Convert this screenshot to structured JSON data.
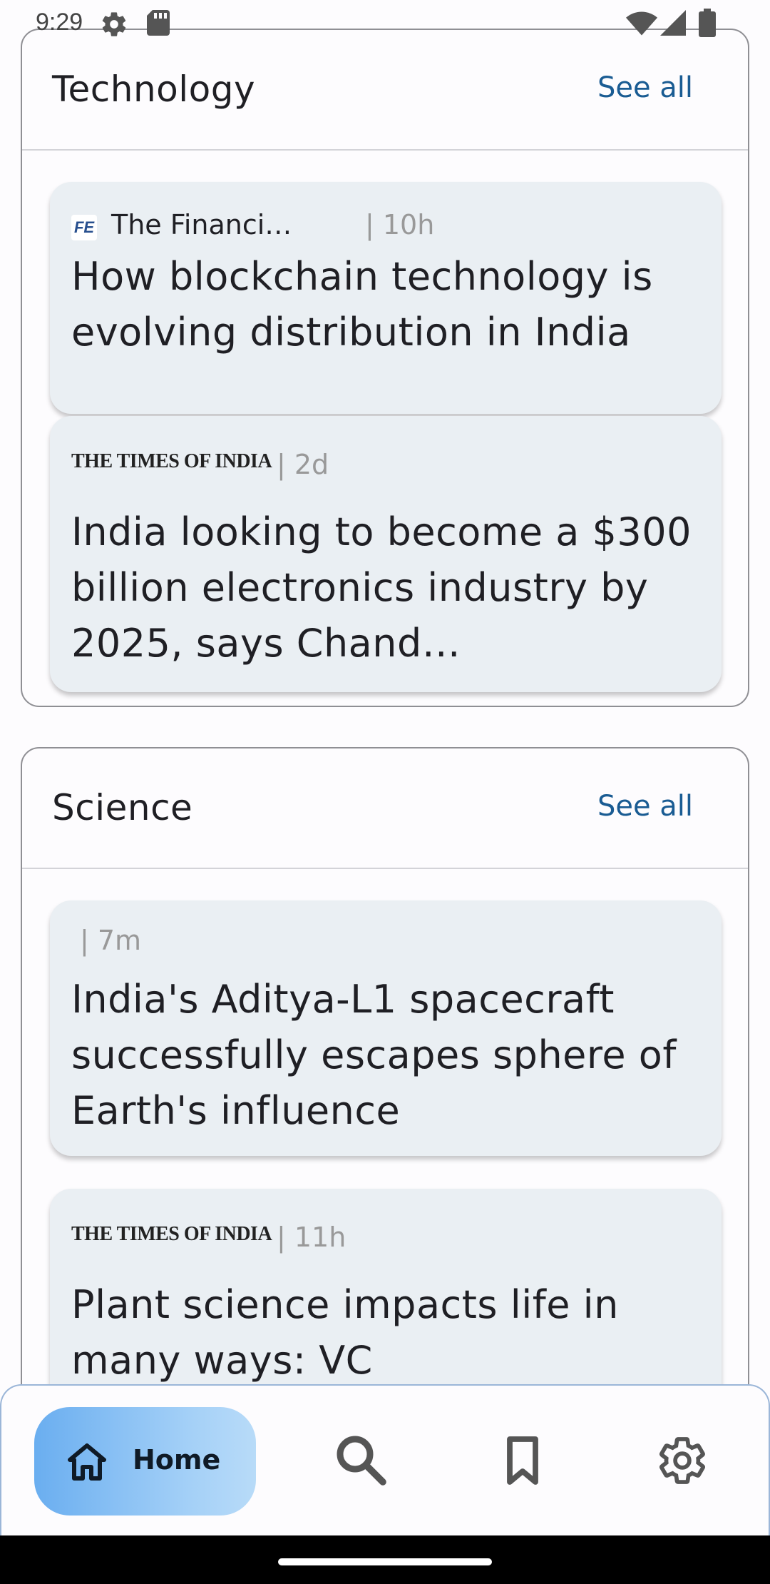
{
  "status_bar": {
    "time": "9:29",
    "icons_left": [
      "settings-gear-icon",
      "sd-card-icon"
    ],
    "icons_right": [
      "wifi-icon",
      "signal-icon",
      "battery-icon"
    ]
  },
  "sections": [
    {
      "title": "Technology",
      "see_all": "See all",
      "articles": [
        {
          "source_logo": "FE",
          "source_name": "The Financi…",
          "age": "| 10h",
          "headline": "How blockchain technology is evolving distribution in India"
        },
        {
          "source_logo": "THE TIMES OF INDIA",
          "age": "| 2d",
          "headline": "India looking to become a $300 billion electronics industry by 2025, says Chand…"
        }
      ]
    },
    {
      "title": "Science",
      "see_all": "See all",
      "articles": [
        {
          "age": "| 7m",
          "headline": "India's Aditya-L1 spacecraft successfully escapes sphere of Earth's influence"
        },
        {
          "source_logo": "THE TIMES OF INDIA",
          "age": "| 11h",
          "headline": "Plant science impacts life in many ways: VC"
        }
      ]
    }
  ],
  "bottom_nav": {
    "home_label": "Home",
    "items": [
      "home-icon",
      "search-icon",
      "bookmark-icon",
      "settings-icon"
    ],
    "active_gradient": [
      "#6aaef0",
      "#b8dbf8"
    ]
  },
  "colors": {
    "accent": "#1a5c93",
    "card_bg": "#eaeff3",
    "meta_text": "#999999"
  }
}
